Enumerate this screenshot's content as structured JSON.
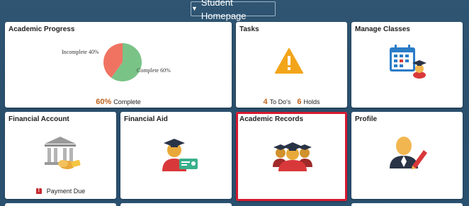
{
  "header": {
    "title": "Student Homepage",
    "dropdown_glyph": "▼"
  },
  "tiles": {
    "academic_progress": {
      "title": "Academic Progress",
      "chart_data": {
        "type": "pie",
        "categories": [
          "Incomplete",
          "Complete"
        ],
        "values": [
          40,
          60
        ],
        "labels": [
          "Incomplete 40%",
          "Complete 60%"
        ],
        "colors": [
          "#f07362",
          "#7ac387"
        ]
      },
      "summary_value": "60%",
      "summary_label": "Complete"
    },
    "tasks": {
      "title": "Tasks",
      "icon": "warning-icon",
      "todo_count": "4",
      "todo_label": "To Do's",
      "holds_count": "6",
      "holds_label": "Holds"
    },
    "manage_classes": {
      "title": "Manage Classes",
      "icon": "class-calendar-icon"
    },
    "financial_account": {
      "title": "Financial Account",
      "icon": "bank-money-icon",
      "status_badge": "!",
      "status": "Payment Due"
    },
    "financial_aid": {
      "title": "Financial Aid",
      "icon": "graduate-check-icon"
    },
    "academic_records": {
      "title": "Academic Records",
      "icon": "graduates-group-icon"
    },
    "profile": {
      "title": "Profile",
      "icon": "person-pencil-icon"
    }
  },
  "colors": {
    "background": "#2b5170",
    "accent_number": "#c0621a",
    "selected_border": "#d7192e"
  }
}
